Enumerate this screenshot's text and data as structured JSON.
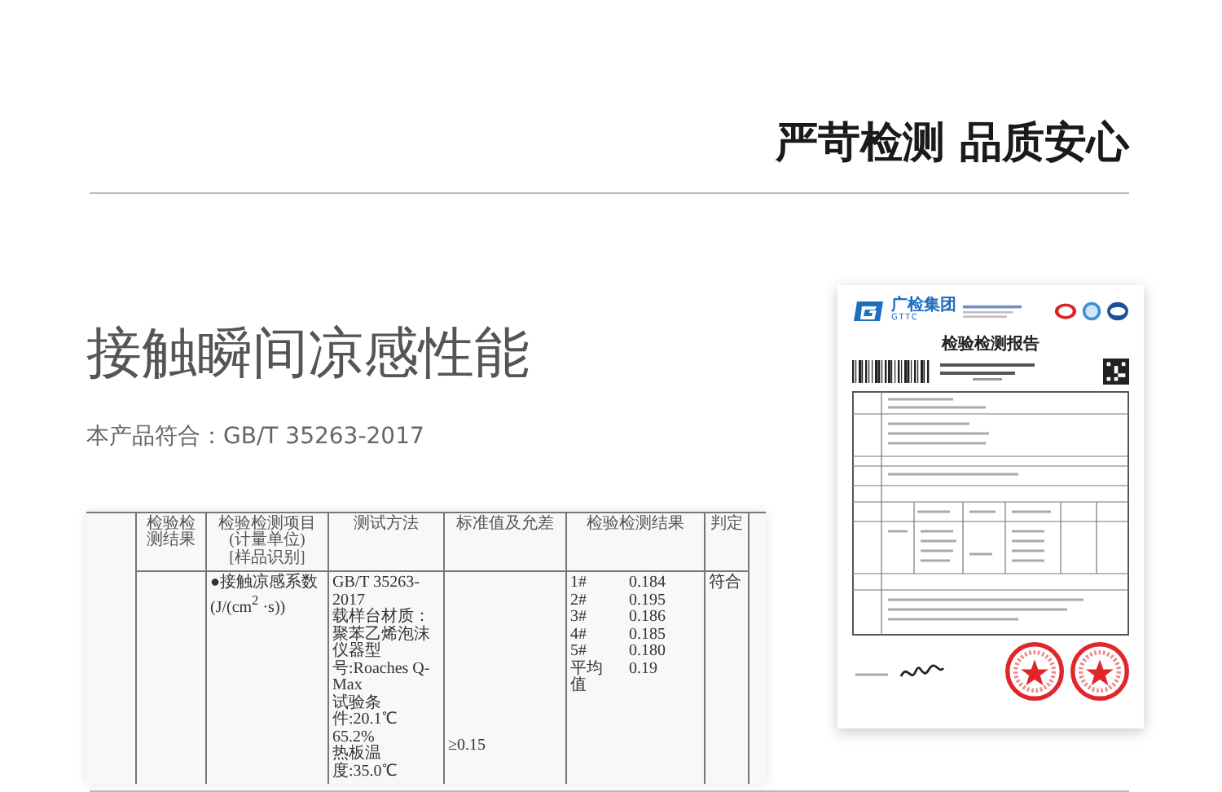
{
  "header": {
    "slogan": "严苛检测 品质安心"
  },
  "feature": {
    "title": "接触瞬间凉感性能",
    "standard_note": "本产品符合：GB/T 35263-2017"
  },
  "results_table": {
    "columns": [
      "检验检测结果",
      [
        "检验检测项目",
        "(计量单位)",
        "[样品识别]"
      ],
      "测试方法",
      "标准值及允差",
      "检验检测结果",
      "判定"
    ],
    "rows": [
      {
        "item": [
          "●接触凉感系数",
          "(J/(cm$^{2}$ ·s))"
        ],
        "method": [
          "GB/T 35263-2017",
          "载样台材质：聚苯乙烯泡沫",
          "仪器型号:Roaches Q-Max",
          "试验条件:20.1℃ 65.2%",
          "热板温度:35.0℃"
        ],
        "standard": "≥0.15",
        "results": [
          [
            "1#",
            "0.184"
          ],
          [
            "2#",
            "0.195"
          ],
          [
            "3#",
            "0.186"
          ],
          [
            "4#",
            "0.185"
          ],
          [
            "5#",
            "0.180"
          ],
          [
            "平均值",
            "0.19"
          ]
        ],
        "verdict": "符合"
      }
    ]
  },
  "report": {
    "company": "广检集团",
    "company_en": "GTTC",
    "title": "检验检测报告"
  }
}
